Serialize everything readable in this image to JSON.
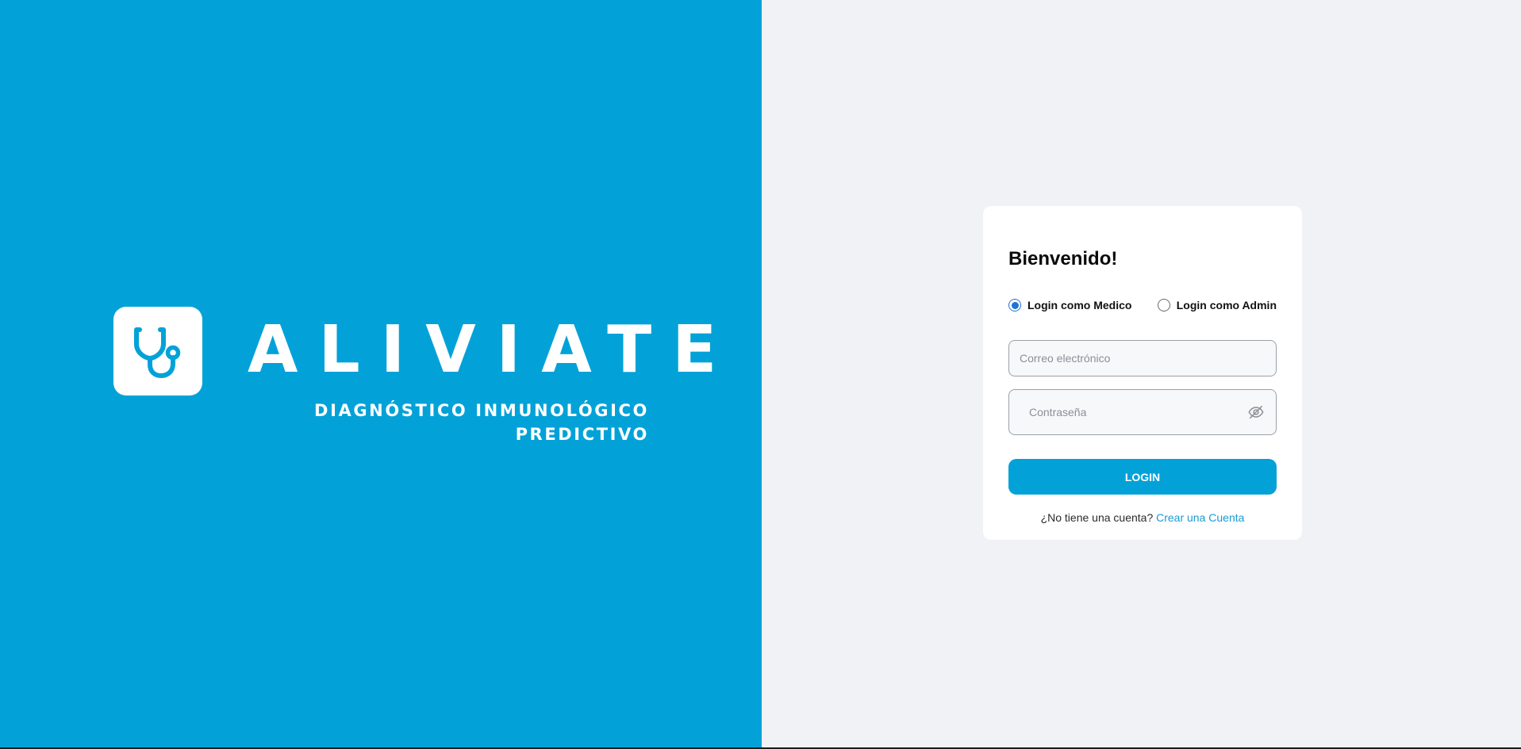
{
  "brand": {
    "name": "ALIVIATE",
    "tagline_lines": [
      "DIAGNÓSTICO INMUNOLÓGICO",
      "PREDICTIVO"
    ],
    "logo_icon": "stethoscope-icon"
  },
  "login_card": {
    "title": "Bienvenido!",
    "roles": [
      {
        "label": "Login como Medico",
        "selected": true
      },
      {
        "label": "Login como Admin",
        "selected": false
      }
    ],
    "email": {
      "value": "",
      "placeholder": "Correo electrónico"
    },
    "password": {
      "value": "",
      "placeholder": "Contraseña",
      "toggle_icon": "eye-off-icon"
    },
    "login_button": "LOGIN",
    "signup_prompt": "¿No tiene una cuenta?",
    "signup_link": "Crear una Cuenta"
  },
  "colors": {
    "brand_blue": "#02a2d8",
    "background": "#f1f2f6",
    "card": "#ffffff",
    "radio_accent": "#1f72d6",
    "link": "#189bd3"
  }
}
